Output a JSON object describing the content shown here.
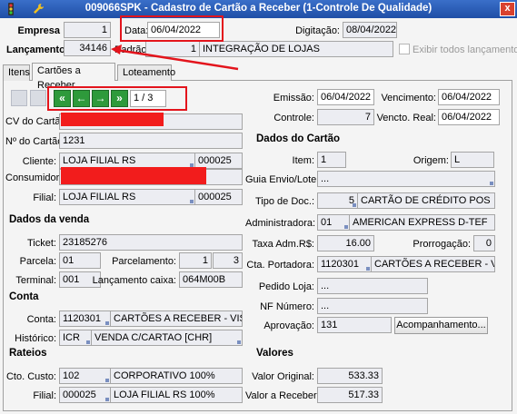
{
  "window": {
    "title": "009066SPK - Cadastro de Cartão a Receber (1-Controle De Qualidade)",
    "close": "x"
  },
  "header": {
    "empresa_label": "Empresa",
    "empresa_value": "1",
    "data_label": "Data:",
    "data_value": "06/04/2022",
    "digitacao_label": "Digitação:",
    "digitacao_value": "08/04/2022",
    "lancamento_label": "Lançamento",
    "lancamento_value": "34146",
    "padrao_label": "Padrão:",
    "padrao_code": "1",
    "padrao_desc": "INTEGRAÇÃO DE LOJAS",
    "exibir_label": "Exibir todos lançamentos"
  },
  "tabs": [
    {
      "label": "Itens"
    },
    {
      "label": "Cartões a Receber"
    },
    {
      "label": "Loteamento"
    }
  ],
  "nav": {
    "first": "«",
    "prev": "←",
    "next": "→",
    "last": "»",
    "page": "1 / 3"
  },
  "left": {
    "cv_label": "CV do Cartão:",
    "num_cartao_label": "Nº do Cartão:",
    "num_cartao_value": "1231",
    "cliente_label": "Cliente:",
    "cliente_value": "LOJA FILIAL RS",
    "cliente_code": "000025",
    "consumidor_label": "Consumidor:",
    "filial_label": "Filial:",
    "filial_value": "LOJA FILIAL RS",
    "filial_code": "000025"
  },
  "venda": {
    "title": "Dados da venda",
    "ticket_label": "Ticket:",
    "ticket_value": "23185276",
    "parcela_label": "Parcela:",
    "parcela_value": "01",
    "parcelamento_label": "Parcelamento:",
    "parcelamento_a": "1",
    "parcelamento_b": "3",
    "terminal_label": "Terminal:",
    "terminal_value": "001",
    "lancamento_caixa_label": "Lançamento caixa:",
    "lancamento_caixa_value": "064M00B"
  },
  "conta": {
    "title": "Conta",
    "conta_label": "Conta:",
    "conta_code": "1120301",
    "conta_desc": "CARTÕES A RECEBER - VISA",
    "historico_label": "Histórico:",
    "historico_code": "ICR",
    "historico_desc": "VENDA C/CARTAO [CHR]"
  },
  "rateios": {
    "title": "Rateios",
    "custo_label": "Cto. Custo:",
    "custo_code": "102",
    "custo_desc": "CORPORATIVO 100%",
    "filial_label": "Filial:",
    "filial_code": "000025",
    "filial_desc": "LOJA FILIAL RS 100%"
  },
  "right_top": {
    "emissao_label": "Emissão:",
    "emissao_value": "06/04/2022",
    "vencimento_label": "Vencimento:",
    "vencimento_value": "06/04/2022",
    "controle_label": "Controle:",
    "controle_value": "7",
    "vencto_real_label": "Vencto. Real:",
    "vencto_real_value": "06/04/2022"
  },
  "cartao": {
    "title": "Dados do Cartão",
    "item_label": "Item:",
    "item_value": "1",
    "origem_label": "Origem:",
    "origem_value": "L",
    "guia_label": "Guia Envio/Lote:",
    "guia_value": "...",
    "tipo_label": "Tipo de Doc.:",
    "tipo_code": "5",
    "tipo_desc": "CARTÃO DE CRÉDITO POS",
    "admin_label": "Administradora:",
    "admin_code": "01",
    "admin_desc": "AMERICAN EXPRESS D-TEF",
    "taxa_label": "Taxa Adm.R$:",
    "taxa_value": "16.00",
    "prorrog_label": "Prorrogação:",
    "prorrog_value": "0",
    "portadora_label": "Cta. Portadora:",
    "portadora_code": "1120301",
    "portadora_desc": "CARTÕES A RECEBER - VISA",
    "pedido_label": "Pedido Loja:",
    "pedido_value": "...",
    "nf_label": "NF Número:",
    "nf_value": "...",
    "aprovacao_label": "Aprovação:",
    "aprovacao_value": "131",
    "acomp_button": "Acompanhamento..."
  },
  "valores": {
    "title": "Valores",
    "original_label": "Valor Original:",
    "original_value": "533.33",
    "receber_label": "Valor a Receber:",
    "receber_value": "517.33"
  },
  "colors": {
    "titlebar": "#1f4ea6",
    "annotation": "#e3141c",
    "redaction": "#f21c1c",
    "nav": "#2e9a3b"
  }
}
